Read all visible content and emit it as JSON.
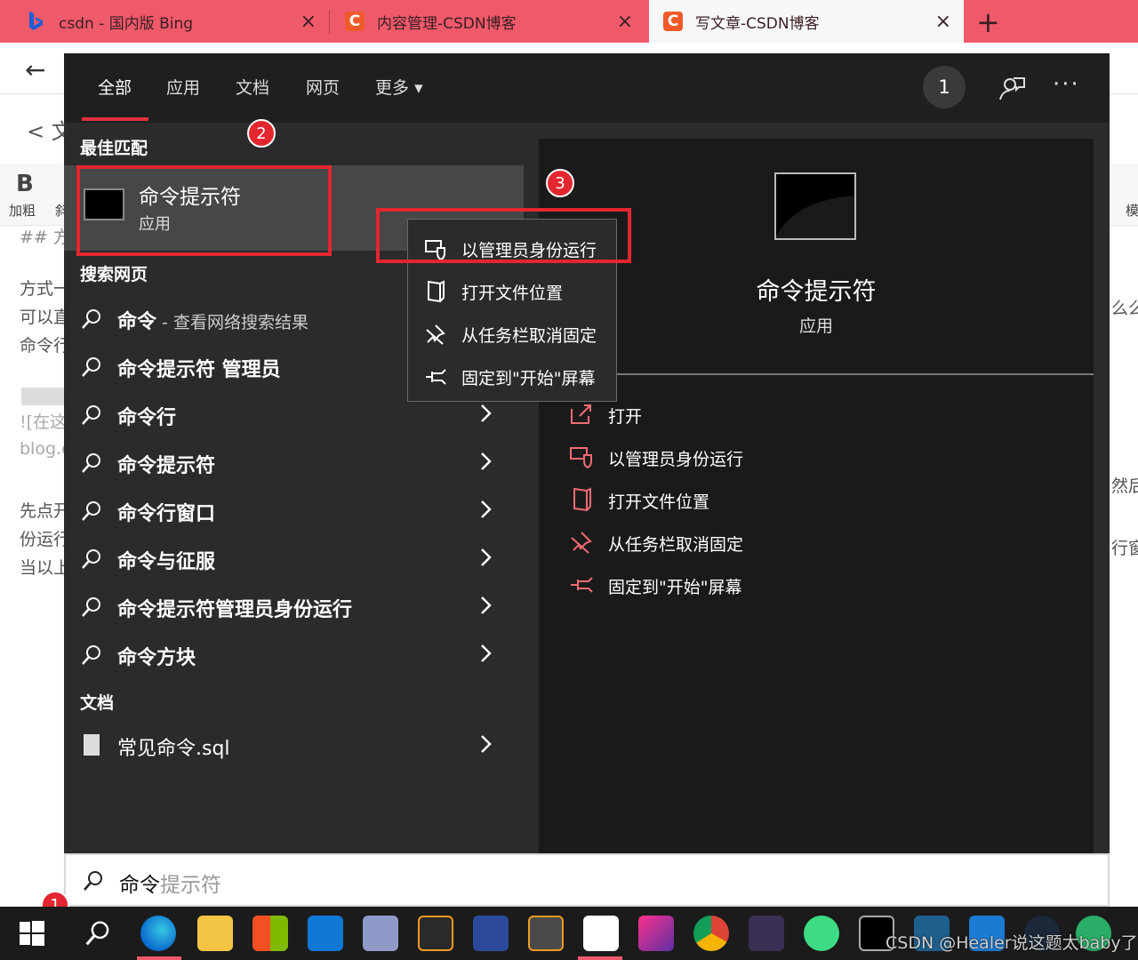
{
  "browser": {
    "tabs": [
      {
        "label": "csdn - 国内版 Bing",
        "icon": "bing-icon"
      },
      {
        "label": "内容管理-CSDN博客",
        "icon": "csdn-icon"
      },
      {
        "label": "写文章-CSDN博客",
        "icon": "csdn-icon"
      }
    ],
    "close_glyph": "×",
    "new_tab_glyph": "+",
    "back_glyph": "←",
    "csdn_letter": "C"
  },
  "background_page": {
    "back_text": "< 文",
    "bold_letter": "B",
    "bold_label": "加粗",
    "italic_partial": "斜",
    "heading": "## 方",
    "lines": [
      "方式一",
      "可以直",
      "命令行",
      "![在这",
      "blog.c",
      "先点开",
      "份运行",
      "当以上"
    ],
    "right_lines": [
      "么么",
      "然后",
      "行窗"
    ],
    "right_icon_letter": "模"
  },
  "start_menu": {
    "tabs": [
      "全部",
      "应用",
      "文档",
      "网页",
      "更多"
    ],
    "more_arrow": "▾",
    "badge_count": "1",
    "more_menu_glyph": "···",
    "best_match_header": "最佳匹配",
    "best_match": {
      "title": "命令提示符",
      "subtitle": "应用"
    },
    "web_header": "搜索网页",
    "web_results": [
      {
        "text": "命令",
        "hint": " - 查看网络搜索结果",
        "chevron": false
      },
      {
        "text": "命令提示符 管理员",
        "hint": "",
        "chevron": false
      },
      {
        "text": "命令行",
        "hint": "",
        "chevron": true
      },
      {
        "text": "命令提示符",
        "hint": "",
        "chevron": true
      },
      {
        "text": "命令行窗口",
        "hint": "",
        "chevron": true
      },
      {
        "text": "命令与征服",
        "hint": "",
        "chevron": true
      },
      {
        "text": "命令提示符管理员身份运行",
        "hint": "",
        "chevron": true
      },
      {
        "text": "命令方块",
        "hint": "",
        "chevron": true
      }
    ],
    "docs_header": "文档",
    "doc_results": [
      {
        "text": "常见命令.sql"
      }
    ],
    "preview": {
      "title": "命令提示符",
      "subtitle": "应用",
      "actions": [
        {
          "label": "打开",
          "icon": "open-icon"
        },
        {
          "label": "以管理员身份运行",
          "icon": "shield-icon"
        },
        {
          "label": "打开文件位置",
          "icon": "file-location-icon"
        },
        {
          "label": "从任务栏取消固定",
          "icon": "unpin-icon"
        },
        {
          "label": "固定到\"开始\"屏幕",
          "icon": "pin-icon"
        }
      ]
    },
    "context_menu": [
      {
        "label": "以管理员身份运行",
        "icon": "shield-icon"
      },
      {
        "label": "打开文件位置",
        "icon": "file-location-icon"
      },
      {
        "label": "从任务栏取消固定",
        "icon": "unpin-icon"
      },
      {
        "label": "固定到\"开始\"屏幕",
        "icon": "pin-icon"
      }
    ]
  },
  "search_box": {
    "typed": "命令",
    "ghost": "提示符"
  },
  "annotations": [
    "1",
    "2",
    "3"
  ],
  "taskbar": {
    "apps": [
      "windows-start-icon",
      "search-icon",
      "edge-icon",
      "file-explorer-icon",
      "store-icon",
      "mail-icon",
      "app-icon",
      "dev-icon",
      "devcpp-icon",
      "sublime-icon",
      "typora-icon",
      "intellij-icon",
      "chrome-icon",
      "wps-icon",
      "android-studio-icon",
      "terminal-icon",
      "mysql-icon",
      "mp-icon",
      "steam-icon",
      "wechat-icon"
    ],
    "watermark": "CSDN @Healer说这题太baby了"
  },
  "colors": {
    "accent_red": "#e3262f",
    "tab_bar": "#ef5a6b",
    "menu_bg": "#2b2b2b"
  }
}
